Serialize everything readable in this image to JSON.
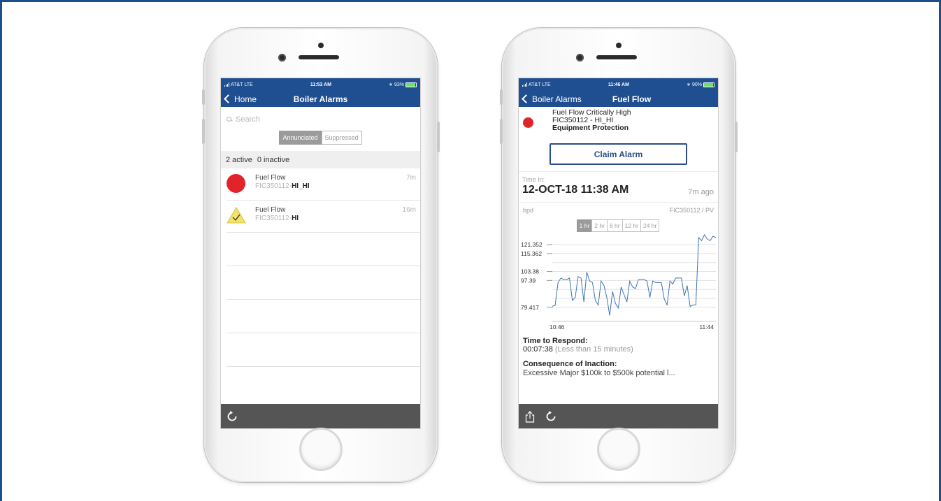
{
  "phones": {
    "left": {
      "status": {
        "carrier": "AT&T",
        "network": "LTE",
        "time": "11:53 AM",
        "battery": "93%",
        "battery_level": 0.93
      },
      "nav": {
        "back_label": "Home",
        "title": "Boiler Alarms"
      },
      "search": {
        "placeholder": "Search"
      },
      "segment": {
        "options": [
          "Annunciated",
          "Suppressed"
        ],
        "selected": "Annunciated"
      },
      "counts": {
        "active_num": "2",
        "active_label": "active",
        "inactive_num": "0",
        "inactive_label": "inactive"
      },
      "alarms": [
        {
          "name": "Fuel Flow",
          "tag_prefix": "FIC350112-",
          "tag_level": "HI_HI",
          "age": "7m",
          "icon": "critical-circle-icon",
          "color": "#e2242a"
        },
        {
          "name": "Fuel Flow",
          "tag_prefix": "FIC350112-",
          "tag_level": "HI",
          "age": "16m",
          "icon": "acknowledged-warning-triangle-icon",
          "color": "#f3e36b"
        }
      ],
      "toolbar": {
        "refresh_icon": "refresh-icon"
      }
    },
    "right": {
      "status": {
        "carrier": "AT&T",
        "network": "LTE",
        "time": "11:46 AM",
        "battery": "90%",
        "battery_level": 0.9
      },
      "nav": {
        "back_label": "Boiler Alarms",
        "title": "Fuel Flow"
      },
      "alarm": {
        "description": "Fuel Flow Critically High",
        "tag": "FIC350112 - HI_HI",
        "category": "Equipment Protection",
        "color": "#e2242a"
      },
      "claim_label": "Claim Alarm",
      "time_in": {
        "label": "Time In:",
        "value": "12-OCT-18 11:38 AM",
        "ago": "7m ago"
      },
      "chart_header": {
        "unit": "bpd",
        "point": "FIC350112 / PV"
      },
      "ranges": {
        "options": [
          "1 hr",
          "2 hr",
          "6 hr",
          "12 hr",
          "24 hr"
        ],
        "selected": "1 hr"
      },
      "respond": {
        "label": "Time to Respond:",
        "value": "00:07:38",
        "note": "(Less than 15 minutes)"
      },
      "consequence": {
        "label": "Consequence of Inaction:",
        "text": "Excessive Major $100k to $500k potential l..."
      },
      "toolbar": {
        "share_icon": "share-icon",
        "refresh_icon": "refresh-icon"
      }
    }
  },
  "chart_data": {
    "type": "line",
    "title": "",
    "xlabel": "",
    "ylabel": "bpd",
    "x_ticks": [
      "10:46",
      "11:44"
    ],
    "y_ticks": [
      79.417,
      97.39,
      103.38,
      115.362,
      121.352
    ],
    "ylim": [
      70,
      127
    ],
    "grid": true,
    "series": [
      {
        "name": "FIC350112 / PV",
        "color": "#3f73b3",
        "values": [
          80,
          81,
          96,
          99,
          98,
          98,
          99,
          84,
          86,
          100,
          99,
          83,
          103,
          97,
          96,
          84,
          81,
          97,
          94,
          86,
          74,
          90,
          82,
          79,
          93,
          88,
          83,
          97,
          93,
          92,
          98,
          98,
          98,
          97,
          86,
          97,
          96,
          96,
          96,
          85,
          81,
          97,
          95,
          99,
          99,
          99,
          87,
          94,
          80,
          81,
          81,
          126,
          124,
          128,
          125,
          124,
          127,
          126
        ]
      }
    ]
  }
}
